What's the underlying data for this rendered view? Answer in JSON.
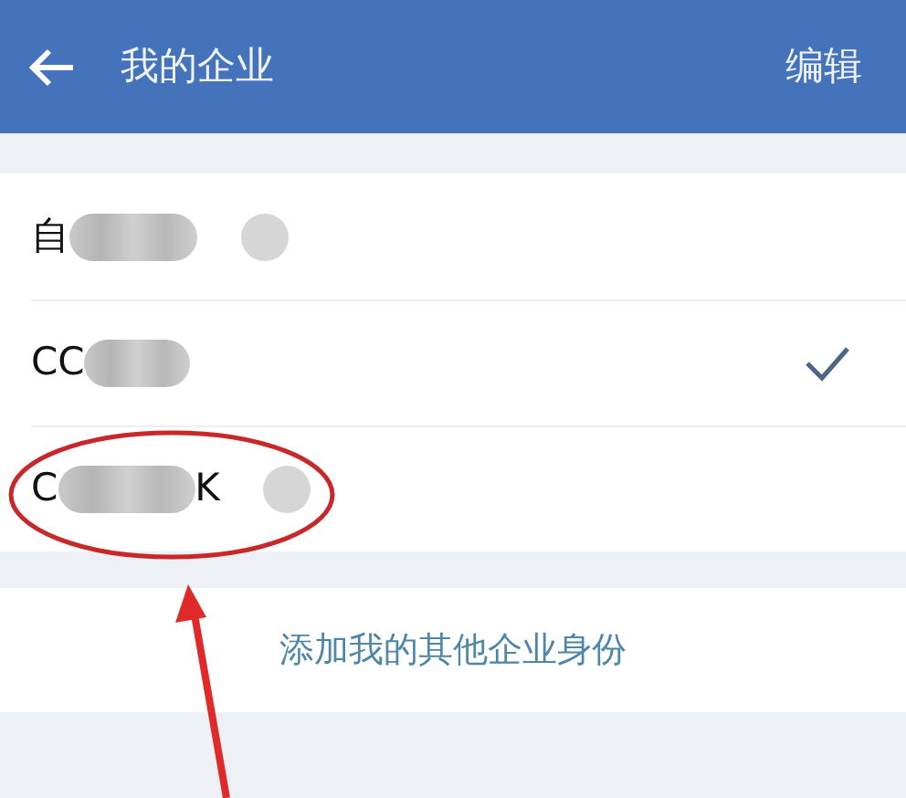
{
  "header": {
    "title": "我的企业",
    "action": "编辑"
  },
  "companies": [
    {
      "prefix": "自",
      "badge": true,
      "selected": false,
      "circled": false
    },
    {
      "prefix": "CC",
      "badge": false,
      "selected": true,
      "circled": false
    },
    {
      "prefix": "C",
      "suffix": "K",
      "badge": true,
      "selected": false,
      "circled": true
    }
  ],
  "add_link": "添加我的其他企业身份"
}
